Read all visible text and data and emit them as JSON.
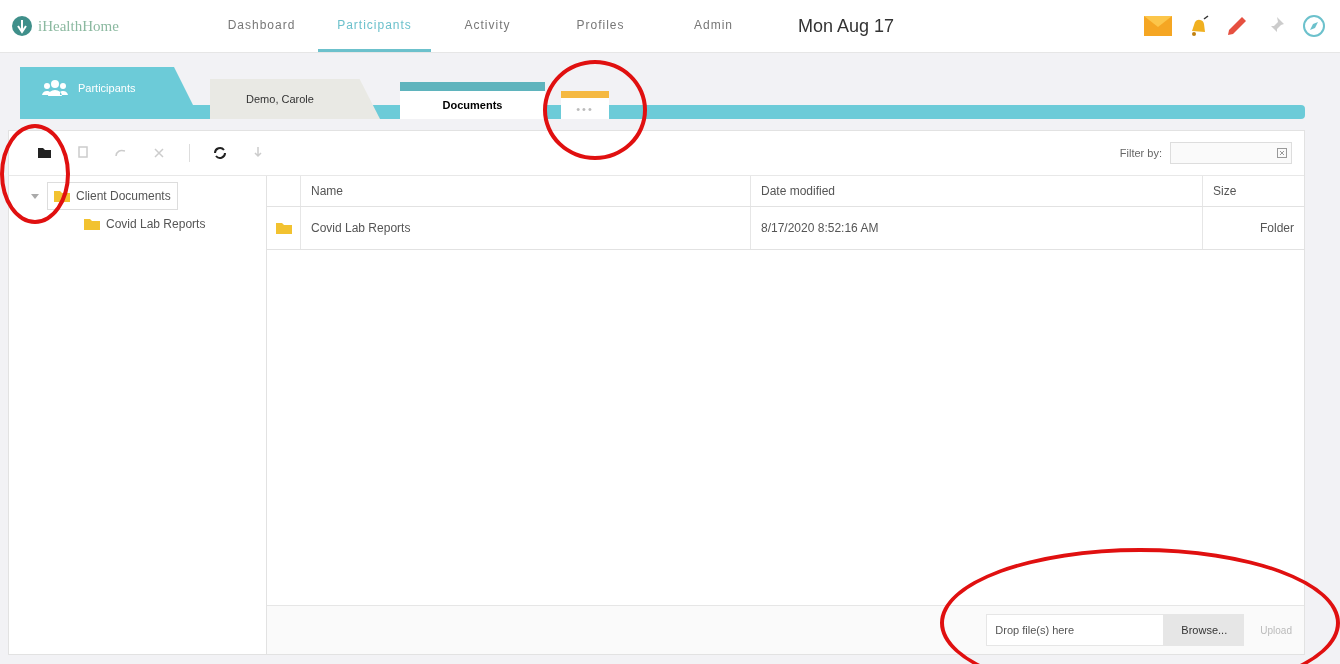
{
  "brand": {
    "name": "iHealthHome"
  },
  "nav": [
    {
      "label": "Dashboard",
      "selected": false
    },
    {
      "label": "Participants",
      "selected": true
    },
    {
      "label": "Activity",
      "selected": false
    },
    {
      "label": "Profiles",
      "selected": false
    },
    {
      "label": "Admin",
      "selected": false
    }
  ],
  "date": "Mon Aug 17",
  "tabs": [
    {
      "kind": "primary",
      "label": "Participants",
      "selected": false
    },
    {
      "kind": "record",
      "label": "Demo, Carole",
      "selected": false
    },
    {
      "kind": "doc",
      "label": "Documents",
      "selected": true
    },
    {
      "kind": "more",
      "label": "•••",
      "selected": false
    }
  ],
  "toolbar": [
    {
      "kind": "new-folder",
      "disabled": false
    },
    {
      "kind": "copy",
      "disabled": true
    },
    {
      "kind": "redo",
      "disabled": true
    },
    {
      "kind": "delete",
      "disabled": true
    },
    {
      "kind": "refresh",
      "disabled": false
    },
    {
      "kind": "download",
      "disabled": true
    }
  ],
  "filter": {
    "label": "Filter by:"
  },
  "tree": [
    {
      "label": "Client Documents",
      "selected": true,
      "expanded": true,
      "children": [
        {
          "label": "Covid Lab Reports",
          "selected": false
        }
      ]
    }
  ],
  "table": {
    "columns": [
      "Name",
      "Date modified",
      "Size"
    ],
    "rows": [
      {
        "name": "Covid Lab Reports",
        "date": "8/17/2020 8:52:16 AM",
        "size": "Folder"
      }
    ]
  },
  "upload": {
    "placeholder": "Drop file(s) here",
    "browse": "Browse...",
    "button": "Upload",
    "upload_disabled": true
  }
}
